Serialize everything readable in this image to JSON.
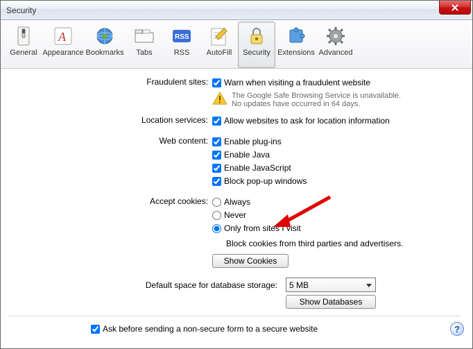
{
  "window": {
    "title": "Security"
  },
  "toolbar": {
    "items": [
      {
        "label": "General"
      },
      {
        "label": "Appearance"
      },
      {
        "label": "Bookmarks"
      },
      {
        "label": "Tabs"
      },
      {
        "label": "RSS"
      },
      {
        "label": "AutoFill"
      },
      {
        "label": "Security"
      },
      {
        "label": "Extensions"
      },
      {
        "label": "Advanced"
      }
    ]
  },
  "labels": {
    "fraudulent": "Fraudulent sites:",
    "location": "Location services:",
    "webcontent": "Web content:",
    "cookies": "Accept cookies:",
    "dbstorage": "Default space for database storage:"
  },
  "options": {
    "warn_fraud": "Warn when visiting a fraudulent website",
    "safe_browsing_line1": "The Google Safe Browsing Service is unavailable.",
    "safe_browsing_line2": "No updates have occurred in 64 days.",
    "allow_location": "Allow websites to ask for location information",
    "enable_plugins": "Enable plug-ins",
    "enable_java": "Enable Java",
    "enable_js": "Enable JavaScript",
    "block_popups": "Block pop-up windows",
    "cookies_always": "Always",
    "cookies_never": "Never",
    "cookies_visited": "Only from sites I visit",
    "cookies_note": "Block cookies from third parties and advertisers.",
    "show_cookies_btn": "Show Cookies",
    "show_db_btn": "Show Databases",
    "db_size": "5 MB",
    "ask_nonsecure": "Ask before sending a non-secure form to a secure website"
  },
  "help": {
    "glyph": "?"
  }
}
